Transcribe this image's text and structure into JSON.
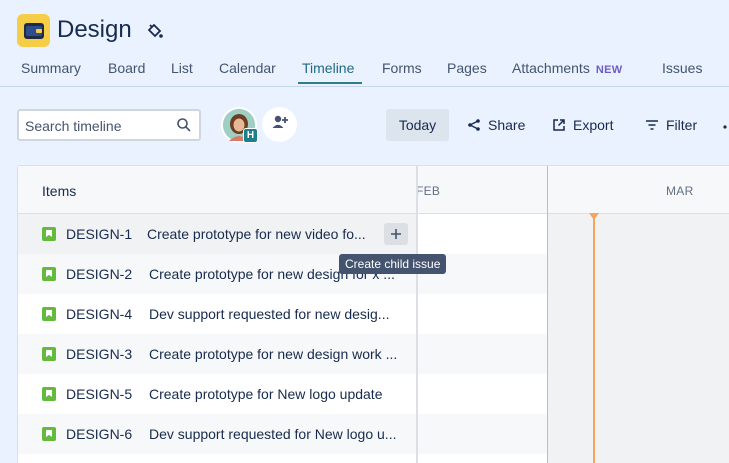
{
  "project": {
    "title": "Design",
    "icon": "project-avatar-icon",
    "accent": "#f5cd47"
  },
  "tabs": [
    {
      "label": "Summary"
    },
    {
      "label": "Board"
    },
    {
      "label": "List"
    },
    {
      "label": "Calendar"
    },
    {
      "label": "Timeline",
      "active": true
    },
    {
      "label": "Forms"
    },
    {
      "label": "Pages"
    },
    {
      "label": "Attachments",
      "badge": "NEW"
    },
    {
      "label": "Issues"
    }
  ],
  "toolbar": {
    "search_placeholder": "Search timeline",
    "avatar_initial": "H",
    "today_label": "Today",
    "share_label": "Share",
    "export_label": "Export",
    "filter_label": "Filter"
  },
  "timeline": {
    "items_header": "Items",
    "months": [
      "FEB",
      "MAR"
    ],
    "tooltip": "Create child issue",
    "today_marker_color": "#f5a55c"
  },
  "issues": [
    {
      "key": "DESIGN-1",
      "summary": "Create prototype for new video fo..."
    },
    {
      "key": "DESIGN-2",
      "summary": "Create prototype for new design for x ..."
    },
    {
      "key": "DESIGN-4",
      "summary": "Dev support requested for new desig..."
    },
    {
      "key": "DESIGN-3",
      "summary": "Create prototype for new design work ..."
    },
    {
      "key": "DESIGN-5",
      "summary": "Create prototype for New logo update"
    },
    {
      "key": "DESIGN-6",
      "summary": "Dev support requested for New logo u..."
    }
  ]
}
